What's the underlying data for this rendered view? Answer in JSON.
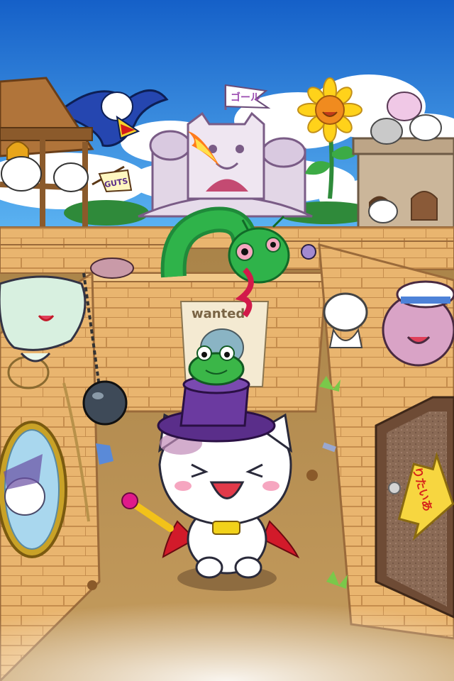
{
  "scene": {
    "goal_flag_text": "ゴール",
    "guts_banner_text": "GUTS",
    "wanted_poster_text": "wanted",
    "exit_sign_text": "りたいあ"
  },
  "colors": {
    "sky": "#1a6fd0",
    "cloud": "#ffffff",
    "maze_wall": "#e7b06d",
    "maze_wall_dark": "#b9804a",
    "floor": "#b08b53",
    "door": "#8f6a4f",
    "exit_sign": "#f7d640"
  },
  "icons": [
    "castle-icon",
    "bird-icon",
    "sunflower-icon",
    "dragon-icon",
    "frog-icon",
    "wrecking-ball-icon",
    "mirror-icon",
    "door-icon",
    "wand-icon"
  ]
}
